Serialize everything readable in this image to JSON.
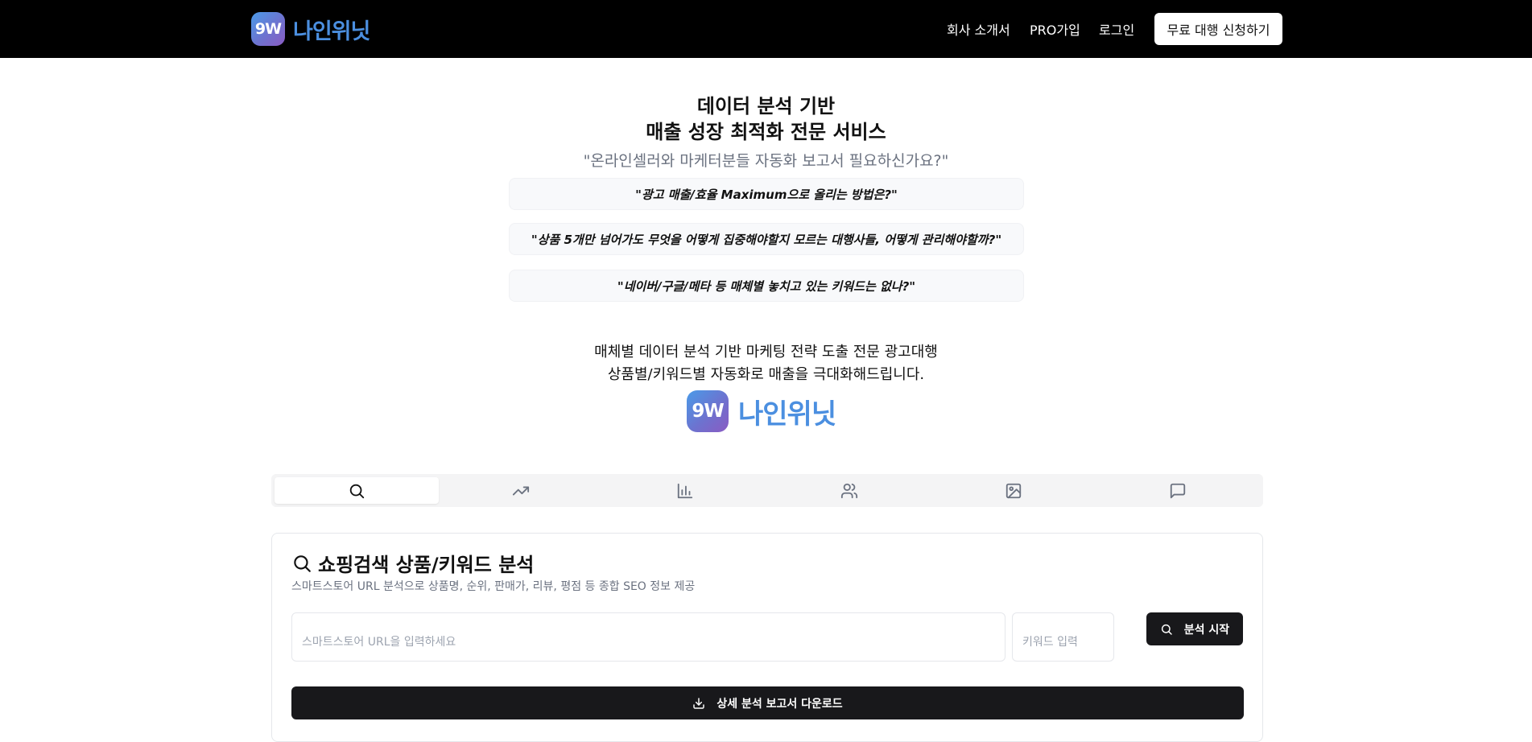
{
  "brand": {
    "badge": "9W",
    "name": "나인위닛"
  },
  "nav": {
    "about": "회사 소개서",
    "pro": "PRO가입",
    "login": "로그인",
    "cta": "무료 대행 신청하기"
  },
  "hero": {
    "title_line1": "데이터 분석 기반",
    "title_line2": "매출 성장 최적화 전문 서비스",
    "subtitle": "\"온라인셀러와 마케터분들 자동화 보고서 필요하신가요?\"",
    "questions": [
      "\"광고 매출/효율 Maximum으로 올리는 방법은?\"",
      "\"상품 5개만 넘어가도 무엇을 어떻게 집중해야할지 모르는 대행사들, 어떻게 관리해야할까?\"",
      "\"네이버/구글/메타 등 매체별 놓치고 있는 키워드는 없나?\""
    ],
    "desc_line1": "매체별 데이터 분석 기반 마케팅 전략 도출 전문 광고대행",
    "desc_line2": "상품별/키워드별 자동화로 매출을 극대화해드립니다."
  },
  "tabs": [
    {
      "icon": "search-icon",
      "active": true
    },
    {
      "icon": "trending-up-icon",
      "active": false
    },
    {
      "icon": "bar-chart-icon",
      "active": false
    },
    {
      "icon": "users-icon",
      "active": false
    },
    {
      "icon": "image-icon",
      "active": false
    },
    {
      "icon": "message-square-icon",
      "active": false
    }
  ],
  "panel": {
    "title": "쇼핑검색 상품/키워드 분석",
    "description": "스마트스토어 URL 분석으로 상품명, 순위, 판매가, 리뷰, 평점 등 종합 SEO 정보 제공",
    "url_placeholder": "스마트스토어 URL을 입력하세요",
    "url_value": "",
    "keyword_placeholder": "키워드 입력",
    "keyword_value": "",
    "analyze_button": "분석 시작",
    "download_button": "상세 분석 보고서 다운로드"
  },
  "colors": {
    "header_bg": "#000000",
    "logo_blue": "#4b8fe0",
    "button_dark": "#18181b",
    "muted_text": "#6b7280"
  }
}
